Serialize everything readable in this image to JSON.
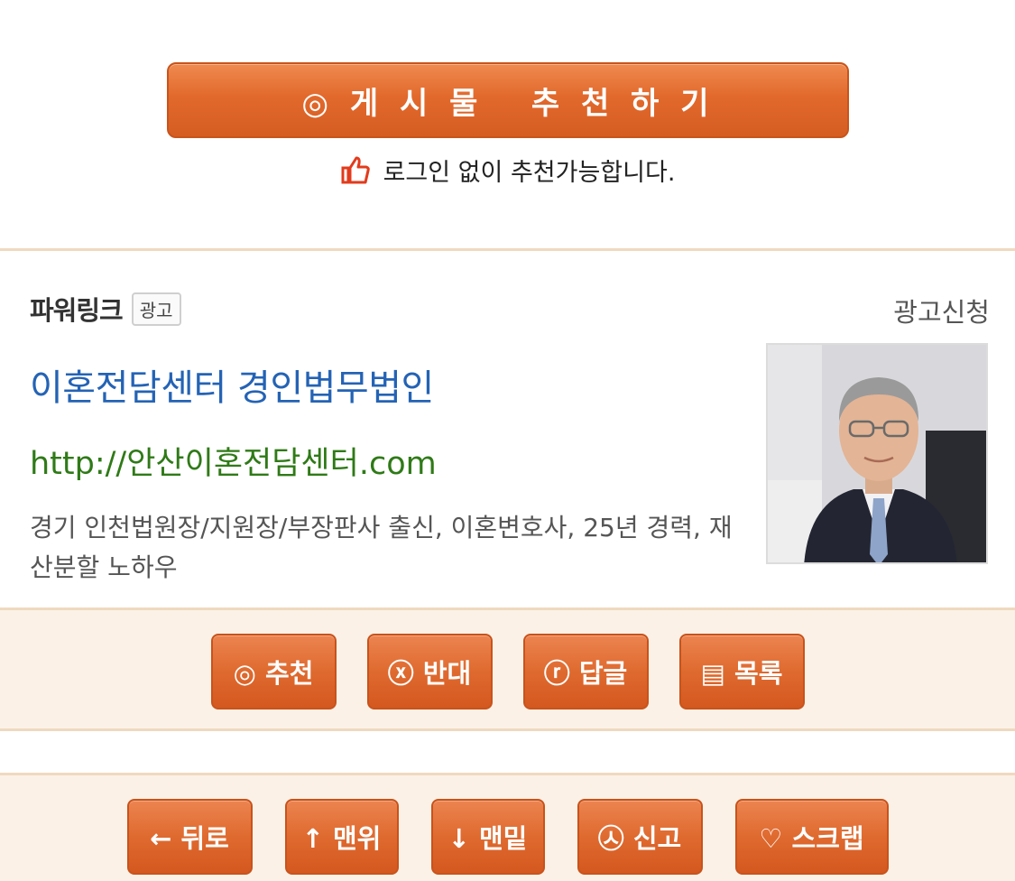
{
  "recommend": {
    "button_label": "◎ 게 시 물   추 천 하 기",
    "hint": "로그인 없이 추천가능합니다."
  },
  "ad": {
    "section_title": "파워링크",
    "badge": "광고",
    "apply_link": "광고신청",
    "title": "이혼전담센터 경인법무법인",
    "url": "http://안산이혼전담센터.com",
    "description": "경기 인천법원장/지원장/부장판사 출신, 이혼변호사, 25년 경력, 재산분할 노하우"
  },
  "action_buttons": [
    {
      "label": "◎ 추천"
    },
    {
      "label": "ⓧ 반대"
    },
    {
      "label": "ⓡ 답글"
    },
    {
      "label": "▤ 목록"
    }
  ],
  "nav_buttons": [
    {
      "label": "← 뒤로"
    },
    {
      "label": "↑ 맨위"
    },
    {
      "label": "↓ 맨밑"
    },
    {
      "label": "㉦ 신고"
    },
    {
      "label": "♡ 스크랩"
    }
  ],
  "colors": {
    "accent": "#df6a2f",
    "ad_title": "#2463b5",
    "ad_url": "#2f7a17",
    "bar_bg": "#fbf1e7",
    "divider": "#efd9bf"
  }
}
